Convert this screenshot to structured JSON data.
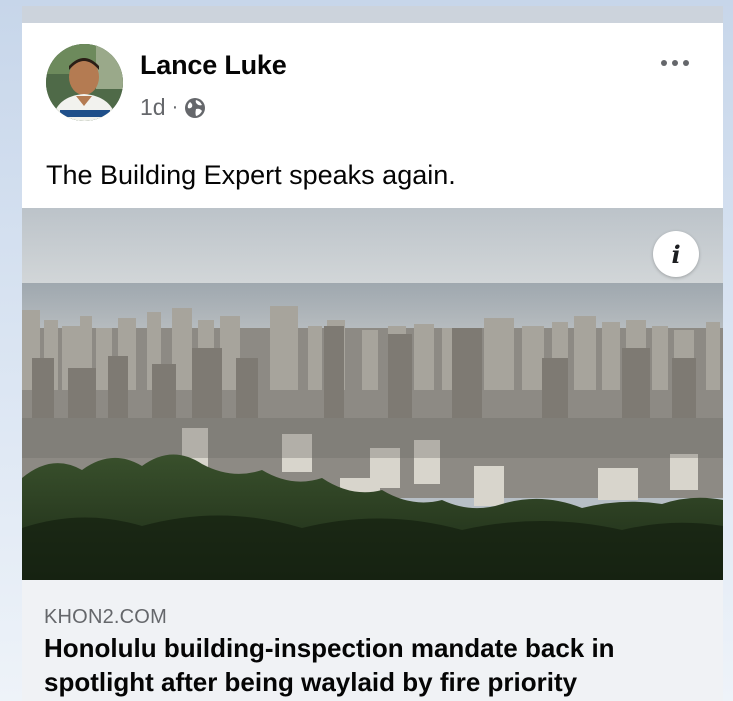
{
  "post": {
    "author": "Lance Luke",
    "time": "1d",
    "separator": "·",
    "privacy_icon": "globe-icon",
    "more_icon": "more-options-icon",
    "text": "The Building Expert speaks again."
  },
  "photo": {
    "info_label": "i",
    "info_icon": "info-icon"
  },
  "link": {
    "domain": "KHON2.COM",
    "title": "Honolulu building-inspection mandate back in spotlight after being waylaid by fire priority"
  },
  "colors": {
    "card_bg": "#ffffff",
    "secondary_text": "#65676b",
    "primary_text": "#050505",
    "link_preview_bg": "#f0f2f5"
  }
}
